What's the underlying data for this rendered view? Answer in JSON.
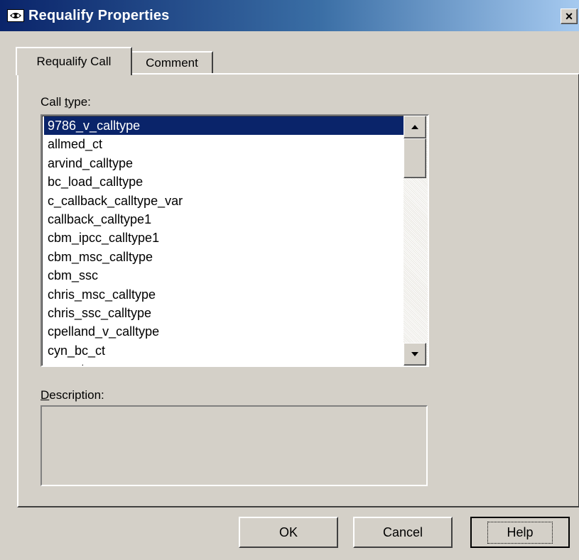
{
  "window": {
    "title": "Requalify Properties",
    "close_glyph": "×"
  },
  "tabs": [
    {
      "label": "Requalify Call",
      "active": true
    },
    {
      "label": "Comment",
      "active": false
    }
  ],
  "call_type": {
    "label_pre": "Call ",
    "label_u": "t",
    "label_post": "ype:",
    "selected_index": 0,
    "items": [
      "9786_v_calltype",
      "allmed_ct",
      "arvind_calltype",
      "bc_load_calltype",
      "c_callback_calltype_var",
      "callback_calltype1",
      "cbm_ipcc_calltype1",
      "cbm_msc_calltype",
      "cbm_ssc",
      "chris_msc_calltype",
      "chris_ssc_calltype",
      "cpelland_v_calltype",
      "cyn_bc_ct",
      "cyn_ct"
    ]
  },
  "description": {
    "label_u": "D",
    "label_post": "escription:",
    "value": ""
  },
  "buttons": {
    "ok": "OK",
    "cancel": "Cancel",
    "help": "Help"
  },
  "icons": {
    "app": "eye-mask-icon",
    "scroll_up": "arrow-up-icon",
    "scroll_down": "arrow-down-icon"
  }
}
